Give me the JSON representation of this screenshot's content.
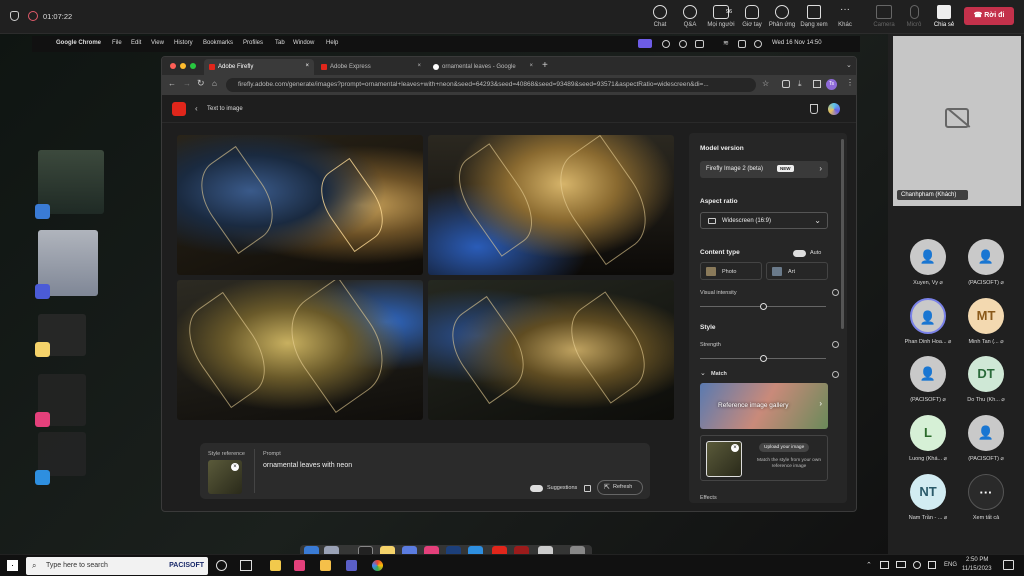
{
  "teams": {
    "timer": "01:07:22",
    "buttons": [
      {
        "label": "Chat"
      },
      {
        "label": "Q&A"
      },
      {
        "label": "Mọi người",
        "count": "96"
      },
      {
        "label": "Giơ tay"
      },
      {
        "label": "Phản ứng"
      },
      {
        "label": "Dạng xem"
      },
      {
        "label": "Khác"
      },
      {
        "label": "Camera"
      },
      {
        "label": "Micrô"
      },
      {
        "label": "Chia sẻ"
      }
    ],
    "leave_label": "Rời đi"
  },
  "mac_menu": {
    "app": "Google Chrome",
    "items": [
      "File",
      "Edit",
      "View",
      "History",
      "Bookmarks",
      "Profiles",
      "Tab",
      "Window",
      "Help"
    ],
    "clock": "Wed 16 Nov  14:50"
  },
  "browser": {
    "tabs": [
      {
        "title": "Adobe Firefly",
        "active": true
      },
      {
        "title": "Adobe Express",
        "active": false
      },
      {
        "title": "ornamental leaves - Google",
        "active": false
      }
    ],
    "url": "firefly.adobe.com/generate/images?prompt=ornamental+leaves+with+neon&seed=64293&seed=40868&seed=93489&seed=93571&aspectRatio=widescreen&di=...",
    "profile": "Ts"
  },
  "firefly": {
    "back_label": "Text to image",
    "panel": {
      "model_heading": "Model version",
      "model_value": "Firefly Image 2 (beta)",
      "model_badge": "NEW",
      "aspect_heading": "Aspect ratio",
      "aspect_value": "Widescreen (16:9)",
      "content_heading": "Content type",
      "auto_label": "Auto",
      "photo_label": "Photo",
      "art_label": "Art",
      "visual_intensity_label": "Visual intensity",
      "visual_intensity_value": 0.5,
      "style_heading": "Style",
      "strength_label": "Strength",
      "strength_value": 0.5,
      "match_label": "Match",
      "gallery_label": "Reference image gallery",
      "upload_label": "Upload your image",
      "upload_hint": "Match the style from your own reference image",
      "effects_label": "Effects"
    },
    "prompt_area": {
      "style_ref_label": "Style reference",
      "prompt_label": "Prompt",
      "prompt_text": "ornamental leaves with neon",
      "suggestions_label": "Suggestions",
      "refresh_label": "Refresh"
    }
  },
  "participants": {
    "presenter": "Chanhpham (Khách)",
    "list": [
      {
        "name": "Xuyen, Vy",
        "initials": "",
        "color": ""
      },
      {
        "name": "(PACISOFT)",
        "initials": "",
        "color": ""
      },
      {
        "name": "Phan Dinh Hoa...",
        "initials": "",
        "color": ""
      },
      {
        "name": "Minh Tan (...",
        "initials": "MT",
        "color": "#f3d9b0"
      },
      {
        "name": "(PACISOFT)",
        "initials": "",
        "color": ""
      },
      {
        "name": "Do Thu (Kh...",
        "initials": "DT",
        "color": "#cfe8d6"
      },
      {
        "name": "Luong (Khá...",
        "initials": "L",
        "color": "#d6f0d6"
      },
      {
        "name": "(PACISOFT)",
        "initials": "",
        "color": ""
      },
      {
        "name": "Nam Trần - ...",
        "initials": "NT",
        "color": "#d2ecf2"
      },
      {
        "name": "Xem tất cả",
        "initials": "···",
        "color": "#2a2a2a"
      }
    ]
  },
  "taskbar": {
    "search_placeholder": "Type here to search",
    "brand": "PACISOFT",
    "lang": "ENG",
    "time": "2:50 PM",
    "date": "11/15/2023"
  }
}
